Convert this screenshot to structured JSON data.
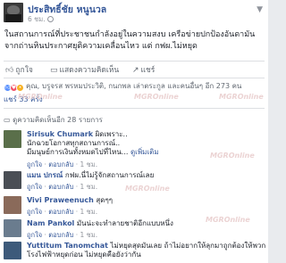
{
  "post": {
    "author": "ประสิทธิ์ชัย หนูนวล",
    "time": "6 ชม.",
    "text_lines": [
      "ในสถานการณ์ที่ประชาชนกำลังอยู่ในความสงบ เครือข่ายปกป้องอันดามัน",
      "จากถ่านหินประกาศยุติความเคลื่อนไหว แต่ กฟผ.ไม่หยุด"
    ],
    "actions": {
      "like": "ถูกใจ",
      "comment": "แสดงความคิดเห็น",
      "share": "แชร์"
    },
    "reactions_text": "คุณ, บรูจรส พรหมประวิติ, กนกพล เล่าตระกูล และคนอื่นๆ อีก 273 คน",
    "shares_text": "แชร์ 33 ครั้ง",
    "comments_header": "ดูความคิดเห็นอีก 28 รายการ"
  },
  "comments": [
    {
      "name": "Sirisuk Chumark",
      "lines": [
        "ผิดเพราะ..",
        "นักฉวยโอกาสทุกสถานการณ์..",
        "มีมนุษย์การเงินทั้งหมดไปที่ไหน..."
      ],
      "first_line_prefix": "ผิดเพราะ..",
      "more": "ดูเพิ่มเติม",
      "like": "ถูกใจ",
      "reply": "ตอบกลับ",
      "time": "1 ชม."
    },
    {
      "name": "แมน ปกรณ์",
      "text": "กฟผ.นี่ไม่รู้จักสถานการณ์เลย",
      "like": "ถูกใจ",
      "reply": "ตอบกลับ",
      "time": "1 ชม."
    },
    {
      "name": "Vivi Praweenuch",
      "text": "สุดๆๆ",
      "like": "ถูกใจ",
      "reply": "ตอบกลับ",
      "time": "1 ชม."
    },
    {
      "name": "Nam Pankol",
      "text": "มันน่ะจะทำลายชาติอีกแบบหนึ่ง",
      "like": "ถูกใจ",
      "reply": "ตอบกลับ",
      "time": "1 ชม."
    },
    {
      "name": "Yuttitum Tanomchat",
      "lines": [
        "ไม่หยุดสุดมันเลย ถ้าไม่อยากให้ลุกมาถูกต้องให้พวก",
        "โรงไฟฟ้าหยุดก่อน ไม่หยุดคือยังว่ากัน"
      ],
      "like": "ถูกใจ",
      "reply": "ตอบกลับ",
      "time": "1 ชม."
    }
  ],
  "watermark": "MGROnline",
  "colors": {
    "link": "#365899",
    "muted": "#90949c",
    "like_reaction": "#5890ff",
    "love_reaction": "#f25268",
    "wow_reaction": "#f7b125"
  }
}
